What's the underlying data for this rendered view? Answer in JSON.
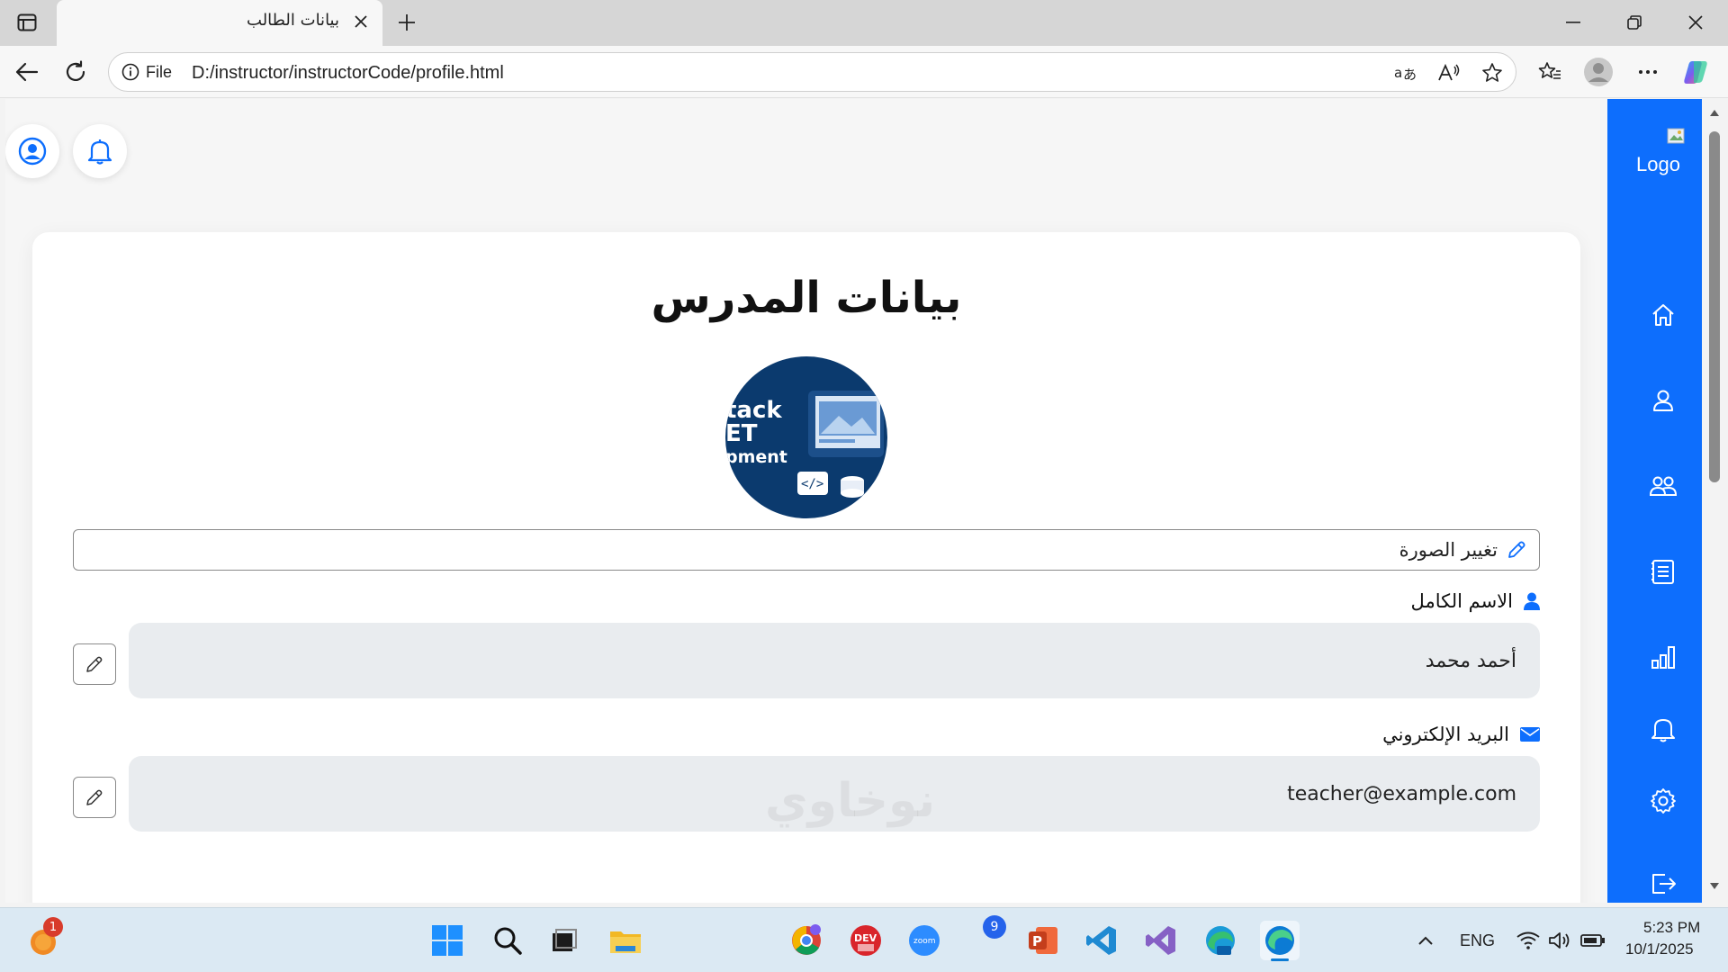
{
  "browser": {
    "tab_title": "بيانات الطالب",
    "address": {
      "scheme_label": "File",
      "url": "D:/instructor/instructorCode/profile.html"
    }
  },
  "page": {
    "title": "بيانات المدرس",
    "avatar": {
      "text_lines": [
        "tack",
        "ET",
        "pment"
      ]
    },
    "change_photo_label": "تغيير الصورة",
    "fields": [
      {
        "label": "الاسم الكامل",
        "value": "أحمد محمد",
        "icon": "user-icon"
      },
      {
        "label": "البريد الإلكتروني",
        "value": "teacher@example.com",
        "icon": "envelope-icon"
      }
    ],
    "watermark": "نوخاوي"
  },
  "sidebar": {
    "logo_text": "Logo",
    "items": [
      "home-icon",
      "profile-icon",
      "students-icon",
      "courses-icon",
      "stats-icon",
      "notifications-icon",
      "settings-icon",
      "logout-icon"
    ]
  },
  "taskbar": {
    "language": "ENG",
    "time": "5:23 PM",
    "date": "10/1/2025",
    "badge_left": "1",
    "badge_chat": "9",
    "devcamp_label": "DEV",
    "zoom_label": "zoom"
  },
  "colors": {
    "sidebar": "#0d6efd",
    "accent": "#0d6efd",
    "field_bg": "#e9ecef"
  }
}
